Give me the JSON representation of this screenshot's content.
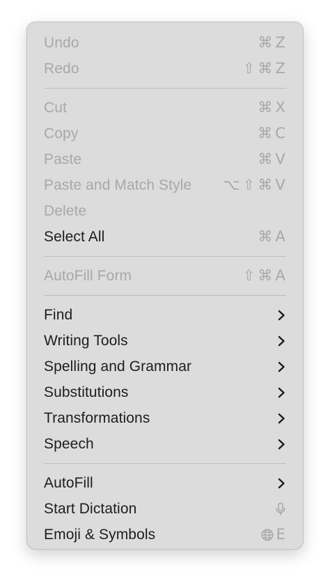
{
  "menu": {
    "groups": [
      {
        "items": [
          {
            "label": "Undo",
            "enabled": false,
            "shortcut": [
              "⌘",
              "Z"
            ]
          },
          {
            "label": "Redo",
            "enabled": false,
            "shortcut": [
              "⇧",
              "⌘",
              "Z"
            ]
          }
        ]
      },
      {
        "items": [
          {
            "label": "Cut",
            "enabled": false,
            "shortcut": [
              "⌘",
              "X"
            ]
          },
          {
            "label": "Copy",
            "enabled": false,
            "shortcut": [
              "⌘",
              "C"
            ]
          },
          {
            "label": "Paste",
            "enabled": false,
            "shortcut": [
              "⌘",
              "V"
            ]
          },
          {
            "label": "Paste and Match Style",
            "enabled": false,
            "shortcut": [
              "⌥",
              "⇧",
              "⌘",
              "V"
            ]
          },
          {
            "label": "Delete",
            "enabled": false,
            "shortcut": []
          },
          {
            "label": "Select All",
            "enabled": true,
            "shortcut": [
              "⌘",
              "A"
            ]
          }
        ]
      },
      {
        "items": [
          {
            "label": "AutoFill Form",
            "enabled": false,
            "shortcut": [
              "⇧",
              "⌘",
              "A"
            ]
          }
        ]
      },
      {
        "items": [
          {
            "label": "Find",
            "enabled": true,
            "submenu": true
          },
          {
            "label": "Writing Tools",
            "enabled": true,
            "submenu": true
          },
          {
            "label": "Spelling and Grammar",
            "enabled": true,
            "submenu": true
          },
          {
            "label": "Substitutions",
            "enabled": true,
            "submenu": true
          },
          {
            "label": "Transformations",
            "enabled": true,
            "submenu": true
          },
          {
            "label": "Speech",
            "enabled": true,
            "submenu": true
          }
        ]
      },
      {
        "items": [
          {
            "label": "AutoFill",
            "enabled": true,
            "submenu": true
          },
          {
            "label": "Start Dictation",
            "enabled": true,
            "icon": "microphone-icon"
          },
          {
            "label": "Emoji & Symbols",
            "enabled": true,
            "icon": "globe-icon",
            "shortcut": [
              "E"
            ]
          }
        ]
      }
    ],
    "colors": {
      "background": "#dcdcdc",
      "text_enabled": "#1d1d1f",
      "text_disabled": "#a8a8a8",
      "separator": "#bdbdbd"
    }
  }
}
